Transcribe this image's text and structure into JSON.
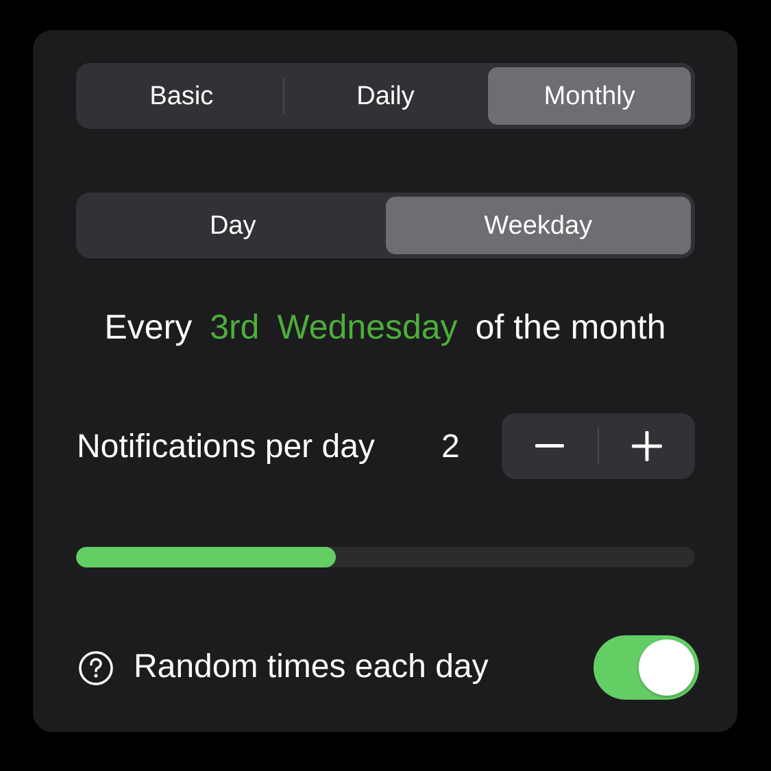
{
  "frequency_tabs": [
    {
      "label": "Basic",
      "selected": false
    },
    {
      "label": "Daily",
      "selected": false
    },
    {
      "label": "Monthly",
      "selected": true
    }
  ],
  "monthly_mode_tabs": [
    {
      "label": "Day",
      "selected": false
    },
    {
      "label": "Weekday",
      "selected": true
    }
  ],
  "schedule": {
    "prefix": "Every",
    "ordinal": "3rd",
    "weekday": "Wednesday",
    "suffix": "of the month"
  },
  "notifications": {
    "label": "Notifications per day",
    "value": "2",
    "decrement_icon": "minus-icon",
    "increment_icon": "plus-icon"
  },
  "progress": {
    "fraction": 0.42
  },
  "random_times": {
    "label": "Random times each day",
    "enabled": true,
    "help_icon": "question-circle-icon"
  },
  "colors": {
    "accent_green": "#63ce64",
    "text_green": "#4caf3a",
    "card_bg": "#1c1c1e",
    "control_bg": "#323236",
    "selected_segment": "#6d6d72"
  }
}
